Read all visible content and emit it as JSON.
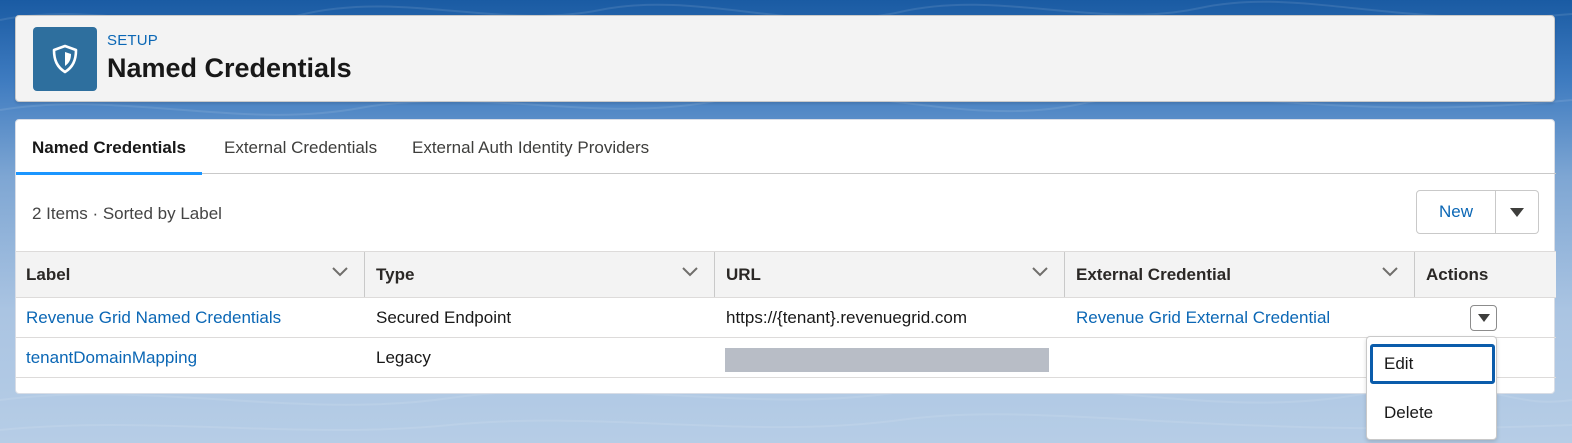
{
  "header": {
    "kicker": "SETUP",
    "title": "Named Credentials",
    "icon": "shield-icon"
  },
  "tabs": [
    {
      "label": "Named Credentials",
      "active": true
    },
    {
      "label": "External Credentials",
      "active": false
    },
    {
      "label": "External Auth Identity Providers",
      "active": false
    }
  ],
  "list": {
    "meta": "2 Items · Sorted by Label",
    "new_label": "New"
  },
  "table": {
    "columns": [
      "Label",
      "Type",
      "URL",
      "External Credential",
      "Actions"
    ],
    "rows": [
      {
        "label": "Revenue Grid Named Credentials",
        "type": "Secured Endpoint",
        "url": "https://{tenant}.revenuegrid.com",
        "external_credential": "Revenue Grid External Credential"
      },
      {
        "label": "tenantDomainMapping",
        "type": "Legacy",
        "url": "",
        "external_credential": ""
      }
    ]
  },
  "row_menu": {
    "items": [
      "Edit",
      "Delete"
    ]
  },
  "colors": {
    "brand_blue": "#0b67b5",
    "tab_active_bar": "#1b96ff",
    "icon_bg": "#2e6f9e"
  }
}
